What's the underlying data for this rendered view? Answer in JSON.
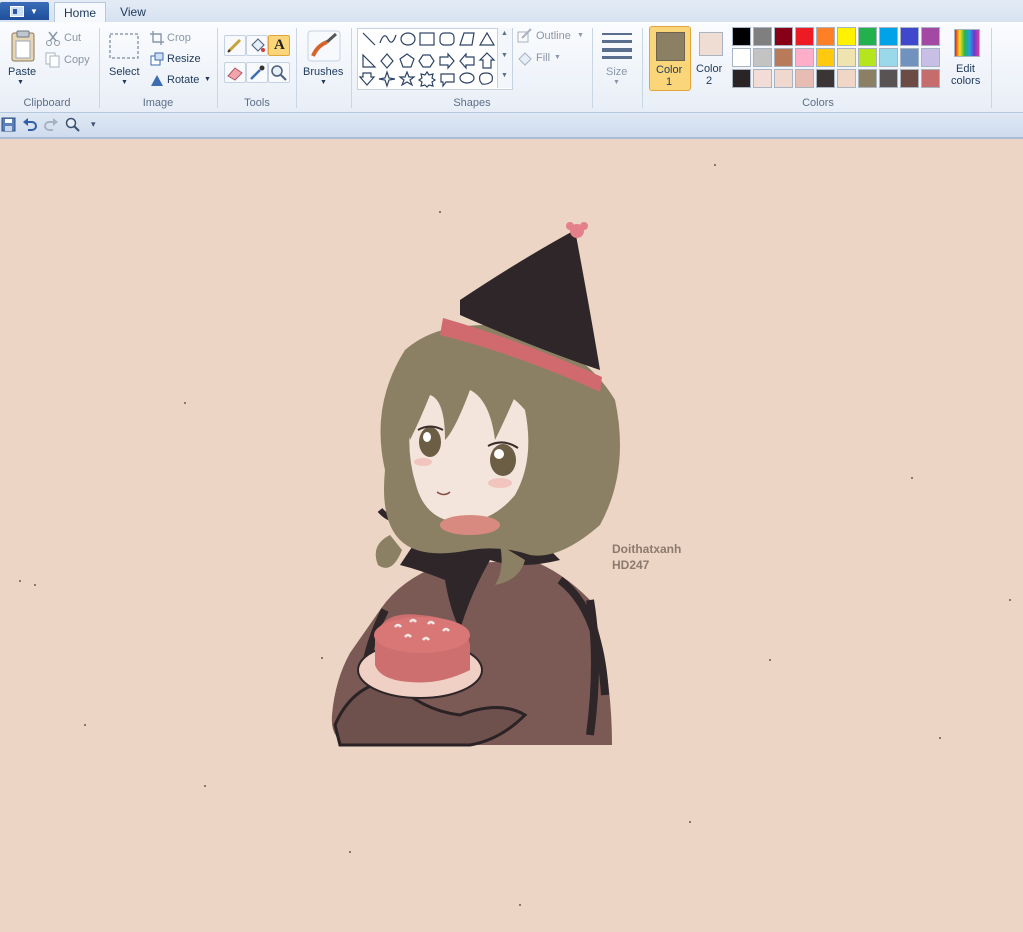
{
  "tabs": {
    "home": "Home",
    "view": "View"
  },
  "clipboard": {
    "paste": "Paste",
    "cut": "Cut",
    "copy": "Copy",
    "group": "Clipboard"
  },
  "image": {
    "select": "Select",
    "crop": "Crop",
    "resize": "Resize",
    "rotate": "Rotate",
    "group": "Image"
  },
  "tools": {
    "group": "Tools"
  },
  "brushes": {
    "label": "Brushes"
  },
  "shapes": {
    "outline": "Outline",
    "fill": "Fill",
    "group": "Shapes"
  },
  "size": {
    "label": "Size"
  },
  "colors": {
    "color1": "Color",
    "color1_num": "1",
    "color2": "Color",
    "color2_num": "2",
    "edit": "Edit",
    "edit2": "colors",
    "group": "Colors",
    "color1_value": "#8b8064",
    "color2_value": "#efddd3",
    "palette": [
      [
        "#000000",
        "#7f7f7f",
        "#880015",
        "#ed1c24",
        "#ff7f27",
        "#fff200",
        "#22b14c",
        "#00a2e8",
        "#3f48cc",
        "#a349a4"
      ],
      [
        "#ffffff",
        "#c3c3c3",
        "#b97a57",
        "#ffaec9",
        "#ffc90e",
        "#efe4b0",
        "#b5e61d",
        "#99d9ea",
        "#7092be",
        "#c8bfe7"
      ],
      [
        "#2a2426",
        "#f1ddd6",
        "#f0d8cf",
        "#e7bdb3",
        "#3b3535",
        "#efd6c6",
        "#8b8064",
        "#595353",
        "#6b4b44",
        "#c56d6d"
      ]
    ]
  },
  "canvas": {
    "bg": "#ecd5c4",
    "watermark_line1": "Doithatxanh",
    "watermark_line2": "HD247"
  }
}
